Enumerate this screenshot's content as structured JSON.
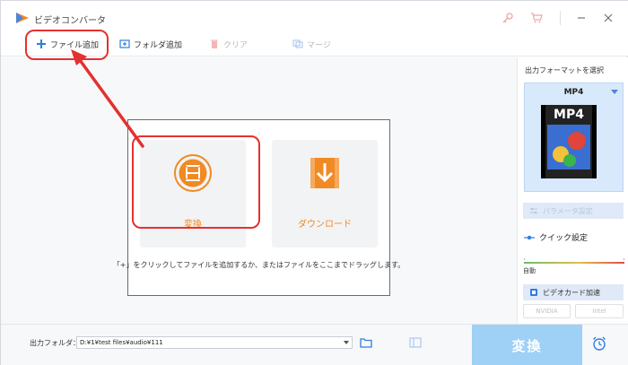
{
  "window": {
    "title": "ビデオコンバータ"
  },
  "toolbar": {
    "add_file": "ファイル追加",
    "add_folder": "フォルダ追加",
    "clear": "クリア",
    "merge": "マージ"
  },
  "main": {
    "convert_card": "変換",
    "download_card": "ダウンロード",
    "hint": "「+」をクリックしてファイルを追加するか、またはファイルをここまでドラッグします。"
  },
  "side": {
    "title": "出力フォーマットを選択",
    "format_name": "MP4",
    "format_thumb_text": "MP4",
    "param_button": "パラメータ設定",
    "quick_settings": "クイック設定",
    "slider_label": "自動",
    "gpu_button": "ビデオカード加速",
    "gpu_nvidia": "NVIDIA",
    "gpu_intel": "Intel"
  },
  "bottom": {
    "output_label": "出力フォルダ：",
    "output_path": "D:¥1¥test files¥audio¥111",
    "convert_button": "変換"
  },
  "colors": {
    "accent_orange": "#f08a24",
    "accent_blue": "#4a86d6",
    "annotation_red": "#e53030",
    "convert_button_bg": "#9fd0f5"
  }
}
